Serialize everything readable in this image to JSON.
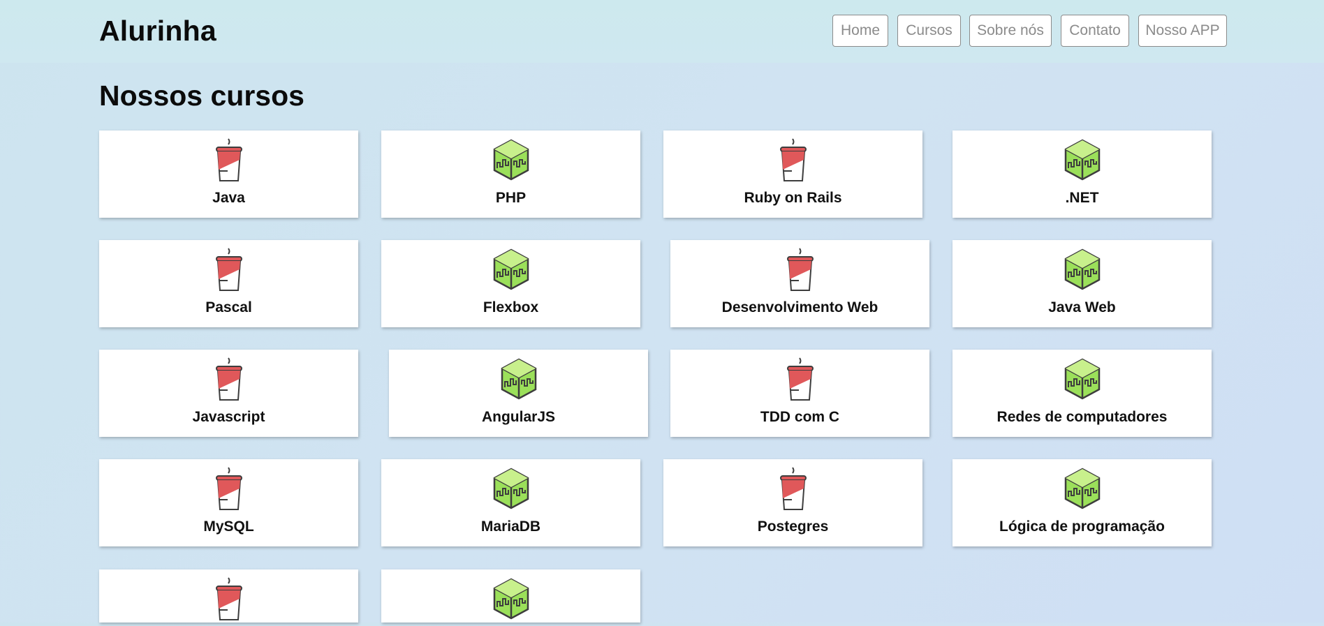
{
  "header": {
    "brand": "Alurinha",
    "nav": [
      {
        "label": "Home"
      },
      {
        "label": "Cursos"
      },
      {
        "label": "Sobre nós"
      },
      {
        "label": "Contato"
      },
      {
        "label": "Nosso APP"
      }
    ]
  },
  "main": {
    "title": "Nossos cursos",
    "courses": [
      {
        "label": "Java",
        "icon": "coffee-cup-icon"
      },
      {
        "label": "PHP",
        "icon": "green-cube-icon"
      },
      {
        "label": "Ruby on Rails",
        "icon": "coffee-cup-icon"
      },
      {
        "label": ".NET",
        "icon": "green-cube-icon"
      },
      {
        "label": "Pascal",
        "icon": "coffee-cup-icon"
      },
      {
        "label": "Flexbox",
        "icon": "green-cube-icon"
      },
      {
        "label": "Desenvolvimento Web",
        "icon": "coffee-cup-icon"
      },
      {
        "label": "Java Web",
        "icon": "green-cube-icon"
      },
      {
        "label": "Javascript",
        "icon": "coffee-cup-icon"
      },
      {
        "label": "AngularJS",
        "icon": "green-cube-icon"
      },
      {
        "label": "TDD com C",
        "icon": "coffee-cup-icon"
      },
      {
        "label": "Redes de computadores",
        "icon": "green-cube-icon"
      },
      {
        "label": "MySQL",
        "icon": "coffee-cup-icon"
      },
      {
        "label": "MariaDB",
        "icon": "green-cube-icon"
      },
      {
        "label": "Postegres",
        "icon": "coffee-cup-icon"
      },
      {
        "label": "Lógica de programação",
        "icon": "green-cube-icon"
      },
      {
        "label": "",
        "icon": "coffee-cup-icon"
      },
      {
        "label": "",
        "icon": "green-cube-icon"
      }
    ]
  },
  "colors": {
    "cup_red": "#e0585a",
    "cube_green": "#9be05a",
    "outline": "#3d3d3d"
  }
}
